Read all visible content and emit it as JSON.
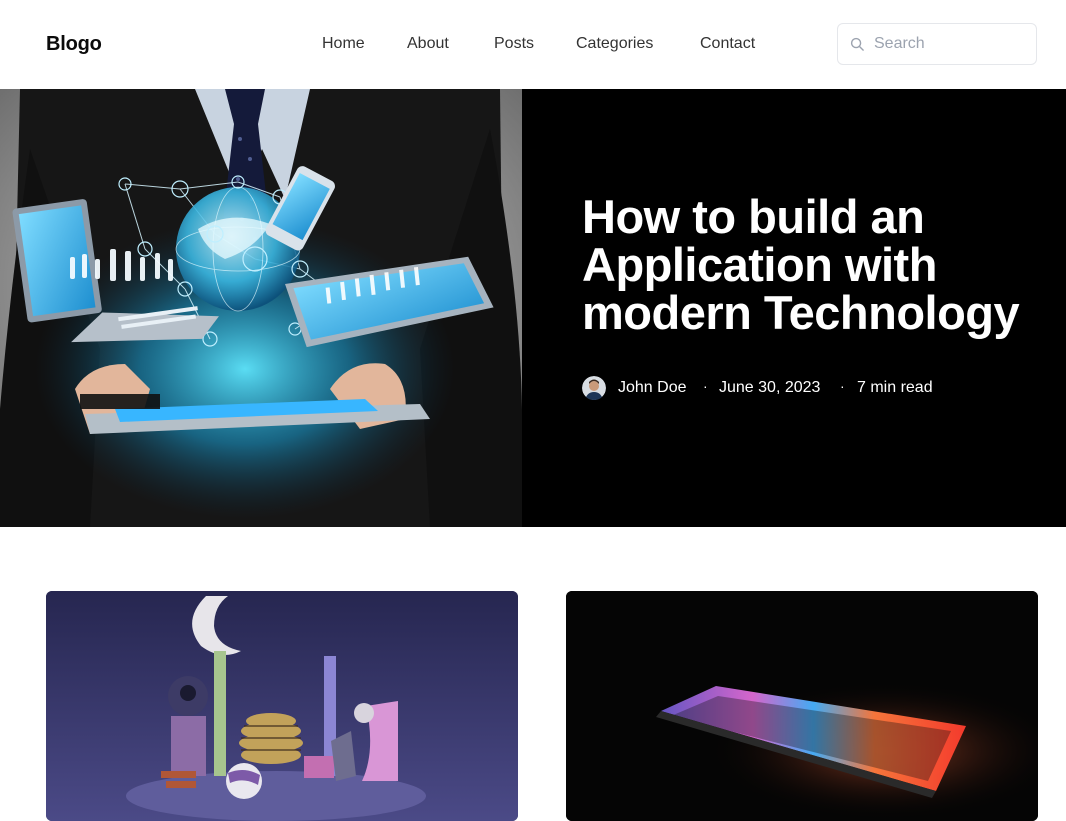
{
  "nav": {
    "logo": "Blogo",
    "links": [
      "Home",
      "About",
      "Posts",
      "Categories",
      "Contact"
    ],
    "search_placeholder": "Search"
  },
  "hero": {
    "title": "How to build an Application with modern Technology",
    "author": "John Doe",
    "separator": "·",
    "date": "June 30, 2023",
    "read_time": "7 min read"
  },
  "colors": {
    "hero_bg": "#000000",
    "text_dark": "#0b0b0b",
    "search_border": "#e5e7eb"
  },
  "icons": {
    "search": "search-icon"
  }
}
